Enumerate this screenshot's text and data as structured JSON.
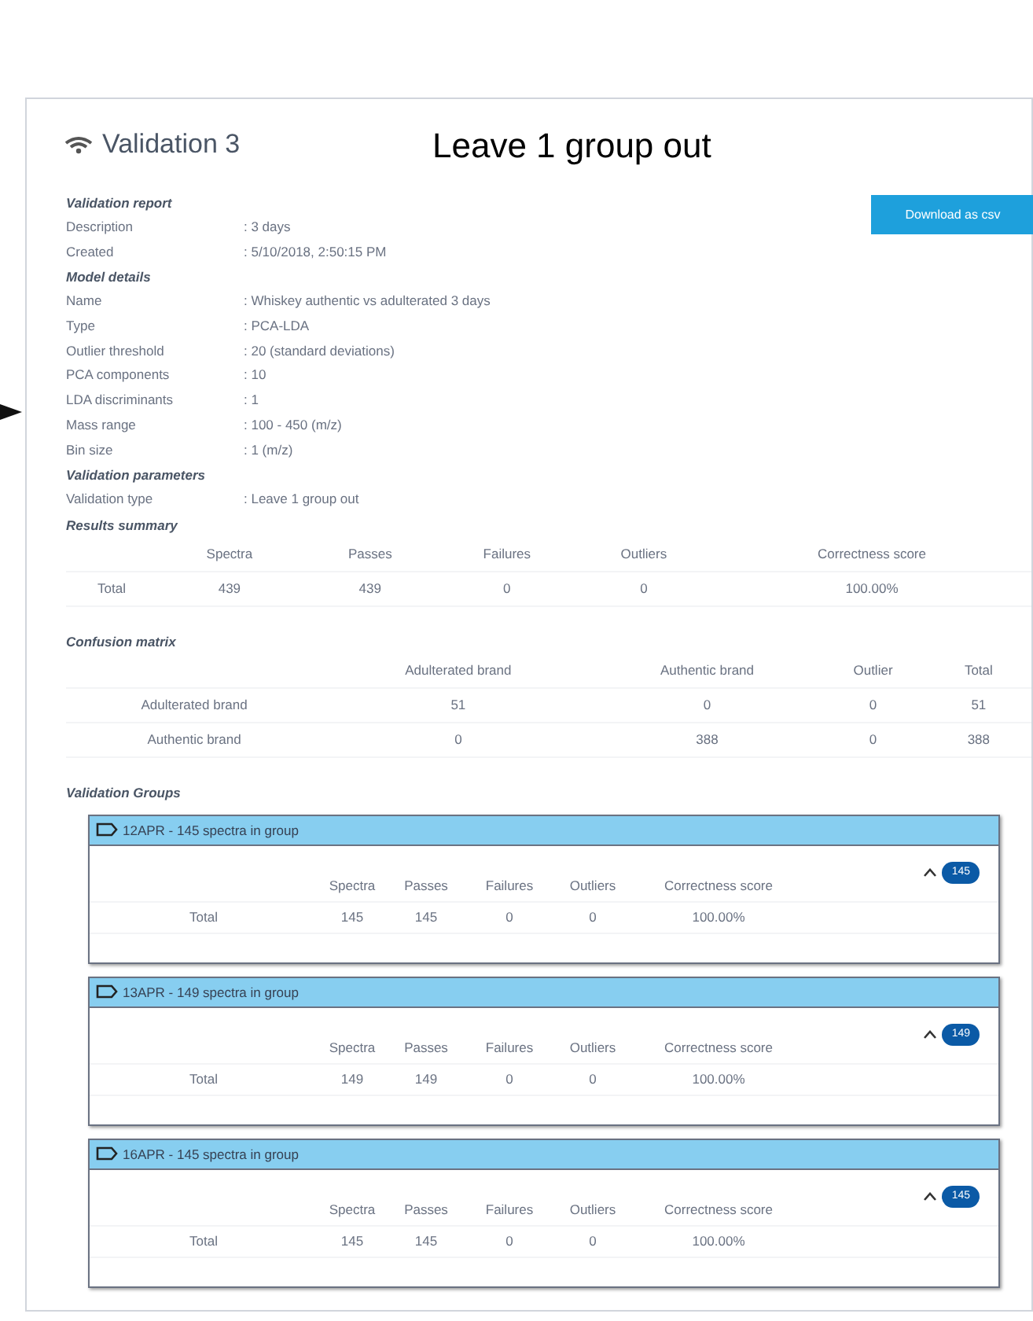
{
  "header": {
    "title": "Validation 3",
    "subtitle": "Leave 1 group out",
    "download_button": "Download as csv"
  },
  "sections": [
    {
      "heading": "Validation report",
      "fields": [
        {
          "label": "Description",
          "value": ": 3 days"
        },
        {
          "label": "Created",
          "value": ": 5/10/2018, 2:50:15 PM"
        }
      ]
    },
    {
      "heading": "Model details",
      "fields": [
        {
          "label": "Name",
          "value": ": Whiskey authentic vs adulterated 3 days"
        },
        {
          "label": "Type",
          "value": ": PCA-LDA"
        },
        {
          "label": "Outlier threshold",
          "value": ": 20 (standard deviations)"
        },
        {
          "label": "PCA components",
          "value": ": 10"
        },
        {
          "label": "LDA discriminants",
          "value": ": 1"
        },
        {
          "label": "Mass range",
          "value": ": 100 - 450 (m/z)"
        },
        {
          "label": "Bin size",
          "value": ": 1 (m/z)"
        }
      ]
    },
    {
      "heading": "Validation parameters",
      "fields": [
        {
          "label": "Validation type",
          "value": ": Leave 1 group out"
        }
      ]
    }
  ],
  "results_summary": {
    "heading": "Results summary",
    "columns": [
      "Spectra",
      "Passes",
      "Failures",
      "Outliers",
      "Correctness score"
    ],
    "rows": [
      {
        "label": "Total",
        "cells": [
          "439",
          "439",
          "0",
          "0",
          "100.00%"
        ]
      }
    ]
  },
  "confusion_matrix": {
    "heading": "Confusion matrix",
    "columns": [
      "Adulterated brand",
      "Authentic brand",
      "Outlier",
      "Total"
    ],
    "rows": [
      {
        "label": "Adulterated brand",
        "cells": [
          "51",
          "0",
          "0",
          "51"
        ]
      },
      {
        "label": "Authentic brand",
        "cells": [
          "0",
          "388",
          "0",
          "388"
        ]
      }
    ]
  },
  "validation_groups": {
    "heading": "Validation Groups",
    "groups": [
      {
        "title": "12APR - 145 spectra in group",
        "expanded": true,
        "badge": "145",
        "columns": [
          "Spectra",
          "Passes",
          "Failures",
          "Outliers",
          "Correctness score"
        ],
        "row": {
          "label": "Total",
          "cells": [
            "145",
            "145",
            "0",
            "0",
            "100.00%"
          ]
        }
      },
      {
        "title": "13APR - 149 spectra in group",
        "expanded": true,
        "badge": "149",
        "columns": [
          "Spectra",
          "Passes",
          "Failures",
          "Outliers",
          "Correctness score"
        ],
        "row": {
          "label": "Total",
          "cells": [
            "149",
            "149",
            "0",
            "0",
            "100.00%"
          ]
        }
      },
      {
        "title": "16APR - 145 spectra in group",
        "expanded": true,
        "badge": "145",
        "columns": [
          "Spectra",
          "Passes",
          "Failures",
          "Outliers",
          "Correctness score"
        ],
        "row": {
          "label": "Total",
          "cells": [
            "145",
            "145",
            "0",
            "0",
            "100.00%"
          ]
        }
      }
    ]
  }
}
